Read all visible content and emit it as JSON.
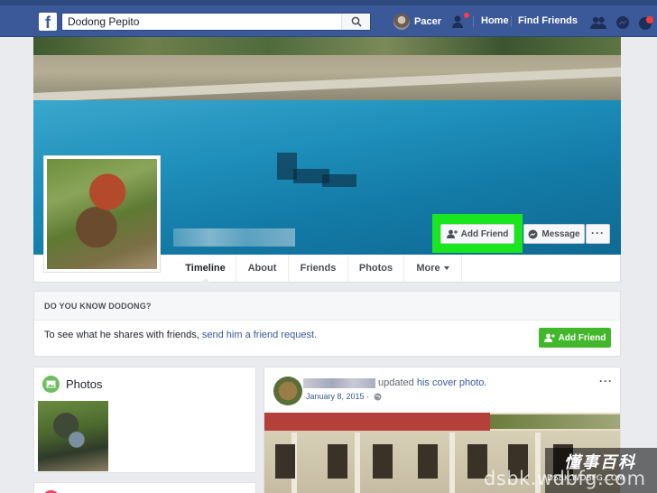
{
  "header": {
    "logo_letter": "f",
    "search_value": "Dodong Pepito",
    "profile_name": "Pacer",
    "nav": [
      "Home",
      "Find Friends"
    ]
  },
  "cover": {
    "add_friend_label": "Add Friend",
    "message_label": "Message",
    "more_label": "···"
  },
  "timeline_tabs": [
    {
      "label": "Timeline"
    },
    {
      "label": "About"
    },
    {
      "label": "Friends"
    },
    {
      "label": "Photos"
    },
    {
      "label": "More"
    }
  ],
  "know_card": {
    "heading": "DO YOU KNOW DODONG?",
    "text": "To see what he shares with friends, ",
    "link": "send him a friend request.",
    "button_label": "Add Friend"
  },
  "photos_card": {
    "title": "Photos"
  },
  "post": {
    "action_text": "updated ",
    "action_link": "his cover photo.",
    "date": "January 8, 2015 · ",
    "more_label": "···"
  },
  "watermark": {
    "chinese": "懂事百科",
    "url_small": "DSBK.WDBFG.COM",
    "url_big": "dsbk.wdbfg.com"
  },
  "colors": {
    "header_blue": "#3b5998",
    "highlight_green": "#19e61f",
    "button_green": "#42b72a",
    "link_blue": "#365899"
  }
}
